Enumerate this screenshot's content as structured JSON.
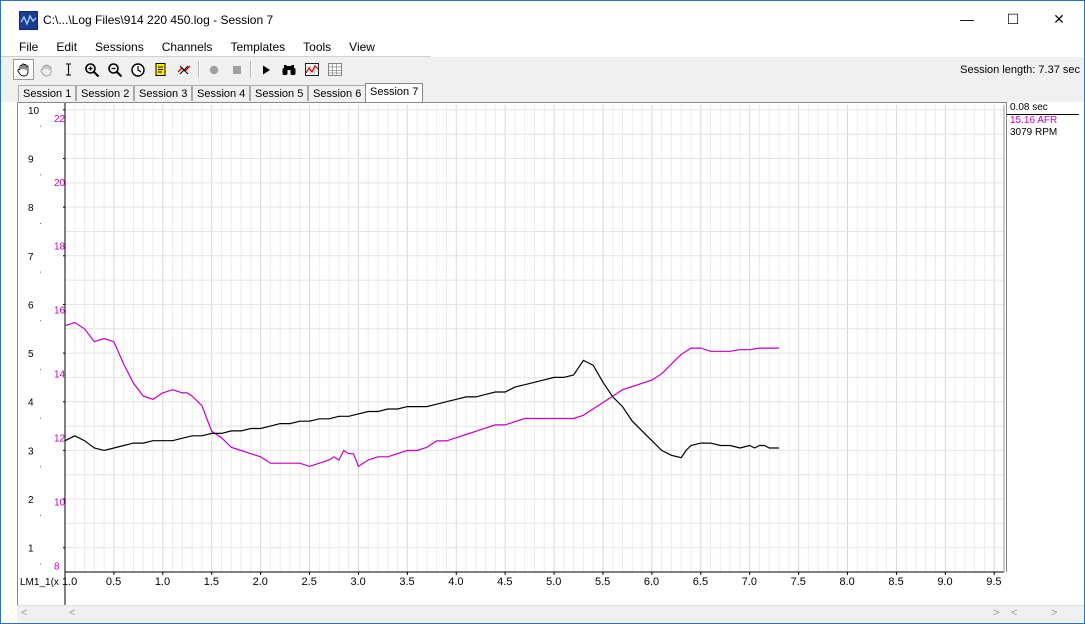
{
  "window": {
    "title": "C:\\...\\Log Files\\914 220 450.log - Session 7",
    "minimize_glyph": "—",
    "maximize_glyph": "☐",
    "close_glyph": "✕"
  },
  "menu": [
    "File",
    "Edit",
    "Sessions",
    "Channels",
    "Templates",
    "Tools",
    "View"
  ],
  "toolbar": {
    "icons": [
      "hand-tool-icon",
      "hand-grab-icon",
      "cursor-i-beam-icon",
      "zoom-in-icon",
      "zoom-out-icon",
      "zoom-reset-icon",
      "notes-icon",
      "clear-icon",
      "record-icon",
      "stop-icon",
      "play-icon",
      "binoculars-icon",
      "chart-icon",
      "grid-icon"
    ],
    "session_length_label": "Session length:",
    "session_length_value": "7.37 sec"
  },
  "tabs": [
    "Session 1",
    "Session 2",
    "Session 3",
    "Session 4",
    "Session 5",
    "Session 6",
    "Session 7"
  ],
  "active_tab": 6,
  "readout": {
    "time": "0.08 sec",
    "afr": "15.16 AFR",
    "rpm": "3079 RPM",
    "afr_color": "#c000c0",
    "rpm_color": "#000000"
  },
  "chart_data": {
    "type": "line",
    "x_axis_label": "LM1_1(x",
    "xlim": [
      0,
      9.6
    ],
    "x_ticks": [
      "1.0",
      "0.5",
      "1.0",
      "1.5",
      "2.0",
      "2.5",
      "3.0",
      "3.5",
      "4.0",
      "4.5",
      "5.0",
      "5.5",
      "6.0",
      "6.5",
      "7.0",
      "7.5",
      "8.0",
      "8.5",
      "9.0",
      "9.5"
    ],
    "y_left": {
      "ticks": [
        "10",
        "9",
        "8",
        "7",
        "6",
        "5",
        "4",
        "3",
        "2",
        "1"
      ],
      "ylim": [
        0.5,
        10.1
      ]
    },
    "y_afr": {
      "ticks": [
        "22",
        "20",
        "18",
        "16",
        "14",
        "12",
        "10",
        "8"
      ],
      "ylim": [
        7.8,
        22.4
      ],
      "color": "#c000c0"
    },
    "grid": true,
    "series": [
      {
        "name": "AFR",
        "color": "#c000c0",
        "axis": "afr",
        "x": [
          0.0,
          0.1,
          0.2,
          0.3,
          0.4,
          0.5,
          0.6,
          0.7,
          0.8,
          0.9,
          1.0,
          1.1,
          1.15,
          1.2,
          1.25,
          1.3,
          1.4,
          1.5,
          1.6,
          1.7,
          1.8,
          1.9,
          2.0,
          2.1,
          2.2,
          2.3,
          2.4,
          2.5,
          2.6,
          2.7,
          2.75,
          2.8,
          2.85,
          2.9,
          2.95,
          3.0,
          3.1,
          3.2,
          3.3,
          3.4,
          3.5,
          3.6,
          3.7,
          3.8,
          3.9,
          4.0,
          4.1,
          4.2,
          4.3,
          4.4,
          4.5,
          4.6,
          4.7,
          4.8,
          4.9,
          5.0,
          5.1,
          5.2,
          5.3,
          5.4,
          5.5,
          5.6,
          5.7,
          5.8,
          5.9,
          6.0,
          6.1,
          6.2,
          6.3,
          6.4,
          6.5,
          6.6,
          6.7,
          6.8,
          6.9,
          7.0,
          7.1,
          7.2,
          7.3
        ],
        "values": [
          15.5,
          15.6,
          15.4,
          15.0,
          15.1,
          15.0,
          14.3,
          13.7,
          13.3,
          13.2,
          13.4,
          13.5,
          13.45,
          13.4,
          13.4,
          13.3,
          13.0,
          12.2,
          12.0,
          11.7,
          11.6,
          11.5,
          11.4,
          11.2,
          11.2,
          11.2,
          11.2,
          11.1,
          11.2,
          11.3,
          11.4,
          11.3,
          11.6,
          11.5,
          11.5,
          11.1,
          11.3,
          11.4,
          11.4,
          11.5,
          11.6,
          11.6,
          11.7,
          11.9,
          11.9,
          12.0,
          12.1,
          12.2,
          12.3,
          12.4,
          12.4,
          12.5,
          12.6,
          12.6,
          12.6,
          12.6,
          12.6,
          12.6,
          12.7,
          12.9,
          13.1,
          13.3,
          13.5,
          13.6,
          13.7,
          13.8,
          14.0,
          14.3,
          14.6,
          14.8,
          14.8,
          14.7,
          14.7,
          14.7,
          14.75,
          14.75,
          14.8,
          14.8,
          14.8
        ]
      },
      {
        "name": "RPM",
        "color": "#000000",
        "axis": "left",
        "x": [
          0.0,
          0.1,
          0.2,
          0.3,
          0.4,
          0.5,
          0.6,
          0.7,
          0.8,
          0.9,
          1.0,
          1.1,
          1.2,
          1.3,
          1.4,
          1.5,
          1.6,
          1.7,
          1.8,
          1.9,
          2.0,
          2.1,
          2.2,
          2.3,
          2.4,
          2.5,
          2.6,
          2.7,
          2.8,
          2.9,
          3.0,
          3.1,
          3.2,
          3.3,
          3.4,
          3.5,
          3.6,
          3.7,
          3.8,
          3.9,
          4.0,
          4.1,
          4.2,
          4.3,
          4.4,
          4.5,
          4.6,
          4.7,
          4.8,
          4.9,
          5.0,
          5.1,
          5.2,
          5.25,
          5.3,
          5.4,
          5.5,
          5.6,
          5.7,
          5.8,
          5.9,
          6.0,
          6.1,
          6.2,
          6.3,
          6.35,
          6.4,
          6.5,
          6.6,
          6.7,
          6.8,
          6.9,
          7.0,
          7.05,
          7.1,
          7.15,
          7.2,
          7.3
        ],
        "values": [
          3.2,
          3.3,
          3.2,
          3.05,
          3.0,
          3.05,
          3.1,
          3.15,
          3.15,
          3.2,
          3.2,
          3.2,
          3.25,
          3.3,
          3.3,
          3.35,
          3.35,
          3.4,
          3.4,
          3.45,
          3.45,
          3.5,
          3.55,
          3.55,
          3.6,
          3.6,
          3.65,
          3.65,
          3.7,
          3.7,
          3.75,
          3.8,
          3.8,
          3.85,
          3.85,
          3.9,
          3.9,
          3.9,
          3.95,
          4.0,
          4.05,
          4.1,
          4.1,
          4.15,
          4.2,
          4.2,
          4.3,
          4.35,
          4.4,
          4.45,
          4.5,
          4.5,
          4.55,
          4.7,
          4.85,
          4.75,
          4.4,
          4.1,
          3.9,
          3.6,
          3.4,
          3.2,
          3.0,
          2.9,
          2.85,
          3.0,
          3.1,
          3.15,
          3.15,
          3.1,
          3.1,
          3.05,
          3.1,
          3.05,
          3.1,
          3.1,
          3.05,
          3.05
        ]
      }
    ]
  }
}
